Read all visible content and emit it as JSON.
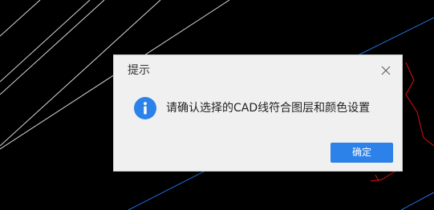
{
  "dialog": {
    "title": "提示",
    "message": "请确认选择的CAD线符合图层和颜色设置",
    "ok_label": "确定",
    "icon": "info-icon",
    "close_icon": "close-icon"
  },
  "colors": {
    "background": "#000000",
    "accent": "#2c82e8",
    "cad_line_white": "#d8d8d8",
    "cad_line_blue": "#1f6fe0",
    "cad_line_red": "#e01010"
  }
}
